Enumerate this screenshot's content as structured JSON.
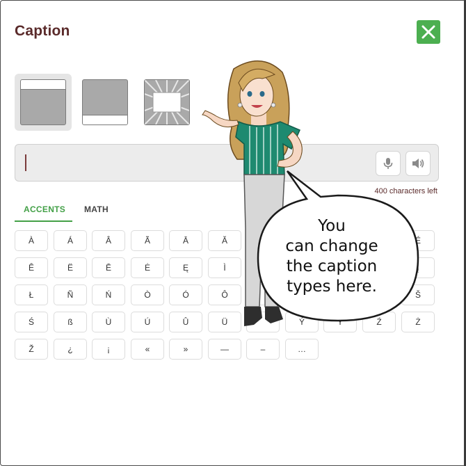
{
  "dialog": {
    "title": "Caption",
    "close_icon": "close-x-icon",
    "accent_color": "#4caf50"
  },
  "caption_types": [
    {
      "name": "top-caption",
      "selected": true
    },
    {
      "name": "bottom-caption",
      "selected": false
    },
    {
      "name": "center-burst-caption",
      "selected": false
    }
  ],
  "input": {
    "value": "",
    "mic_icon": "microphone-icon",
    "speaker_icon": "speaker-icon",
    "chars_left": "400 characters left"
  },
  "tabs": {
    "accents": "ACCENTS",
    "math": "MATH",
    "active": "accents"
  },
  "keys": {
    "row1": [
      "À",
      "Á",
      "Â",
      "Ã",
      "Ā",
      "Ă",
      "",
      "",
      "",
      "",
      "",
      "É"
    ],
    "row2": [
      "Ê",
      "Ë",
      "Ē",
      "Ė",
      "Ę",
      "Ì",
      "",
      "",
      "",
      "",
      "",
      "Į"
    ],
    "row3": [
      "Ł",
      "Ñ",
      "Ń",
      "Ò",
      "Ó",
      "Ô",
      "",
      "",
      "",
      "",
      "",
      "Š"
    ],
    "row4": [
      "Ś",
      "ß",
      "Ù",
      "Ú",
      "Û",
      "Ü",
      "",
      "Ý",
      "Ÿ",
      "",
      "Ź",
      "Ż"
    ],
    "row5": [
      "Ž",
      "¿",
      "¡",
      "«",
      "»",
      "—",
      "–",
      "…"
    ]
  },
  "speech_bubble": {
    "lines": [
      "You",
      "can change",
      "the caption",
      "types here."
    ]
  }
}
